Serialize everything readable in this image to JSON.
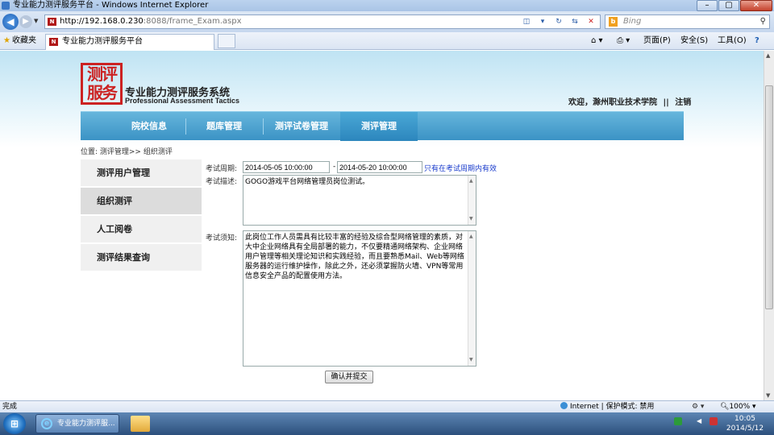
{
  "window": {
    "title": "专业能力测评服务平台 - Windows Internet Explorer",
    "min": "–",
    "max": "▢",
    "close": "✕"
  },
  "address": {
    "host": "http://192.168.0.230",
    "rest": ":8088/frame_Exam.aspx",
    "search_placeholder": "Bing"
  },
  "favbar": {
    "favorites": "收藏夹",
    "tab_title": "专业能力测评服务平台",
    "page_menu": "页面(P)",
    "safety_menu": "安全(S)",
    "tools_menu": "工具(O)",
    "help": "?"
  },
  "site": {
    "logo_text": "测评服务",
    "title": "专业能力测评服务系统",
    "subtitle": "Professional Assessment Tactics",
    "welcome": "欢迎，滁州职业技术学院",
    "sep": "||",
    "logout": "注销"
  },
  "nav": [
    {
      "label": "院校信息"
    },
    {
      "label": "题库管理"
    },
    {
      "label": "测评试卷管理"
    },
    {
      "label": "测评管理"
    }
  ],
  "breadcrumb": "位置: 测评管理>> 组织测评",
  "sidebar": [
    {
      "label": "测评用户管理"
    },
    {
      "label": "组织测评"
    },
    {
      "label": "人工阅卷"
    },
    {
      "label": "测评结果查询"
    }
  ],
  "form": {
    "period_label": "考试周期:",
    "start": "2014-05-05 10:00:00",
    "dash": "-",
    "end": "2014-05-20 10:00:00",
    "period_note": "只有在考试周期内有效",
    "desc_label": "考试描述:",
    "desc_value": "GOGO游戏平台网络管理员岗位测试。",
    "notice_label": "考试须知:",
    "notice_value": "此岗位工作人员需具有比较丰富的经验及综合型网络管理的素质，对大中企业网络具有全局部署的能力，不仅要精通网络架构、企业网络用户管理等相关理论知识和实践经验，而且要熟悉Mail、Web等网络服务器的运行维护操作，除此之外，还必须掌握防火墙、VPN等常用信息安全产品的配置使用方法。",
    "submit": "确认并提交"
  },
  "status": {
    "done": "完成",
    "zone": "Internet | 保护模式: 禁用",
    "zoom": "100%"
  },
  "taskbar": {
    "task_label": "专业能力测评服...",
    "time": "10:05",
    "date": "2014/5/12"
  }
}
